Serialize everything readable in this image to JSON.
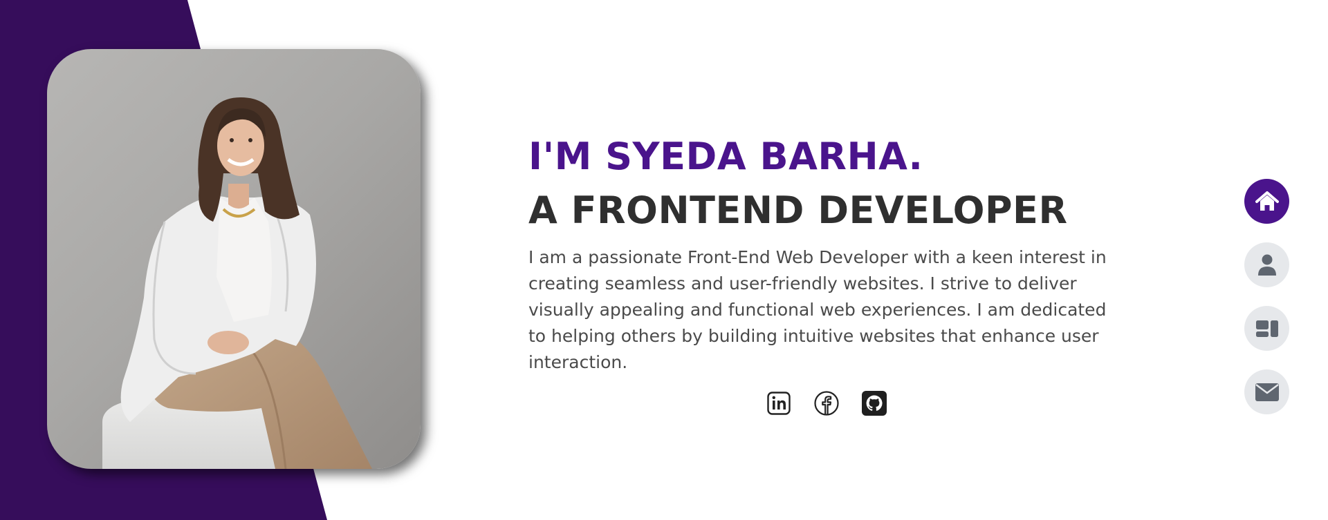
{
  "hero": {
    "title": "I'M SYEDA BARHA.",
    "subtitle": "A FRONTEND DEVELOPER",
    "description": "I am a passionate Front-End Web Developer with a keen interest in creating seamless and user-friendly websites. I strive to deliver visually appealing and functional web experiences. I am dedicated to helping others by building intuitive websites that enhance user interaction."
  },
  "social_links": [
    {
      "icon": "linkedin-icon"
    },
    {
      "icon": "facebook-icon"
    },
    {
      "icon": "github-icon"
    }
  ],
  "side_nav": [
    {
      "icon": "home-icon",
      "active": true
    },
    {
      "icon": "user-icon",
      "active": false
    },
    {
      "icon": "portfolio-icon",
      "active": false
    },
    {
      "icon": "mail-icon",
      "active": false
    }
  ],
  "colors": {
    "accent": "#4a148c",
    "background_shape": "#360d5b",
    "heading_dark": "#2f2f2f",
    "body_text": "#4a4a4a",
    "nav_inactive_bg": "#e6e8eb",
    "nav_inactive_icon": "#5f6670"
  }
}
